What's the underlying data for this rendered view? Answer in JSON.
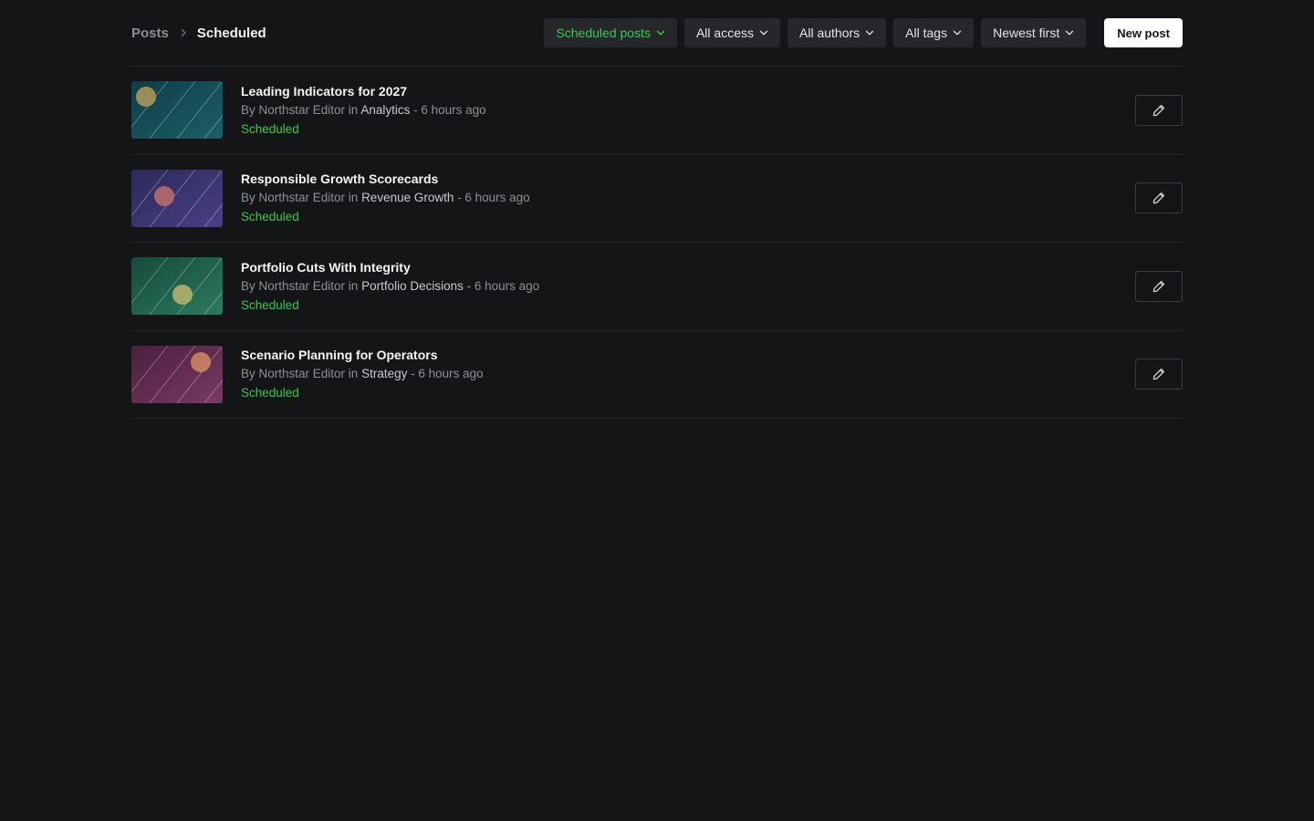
{
  "breadcrumb": {
    "root": "Posts",
    "current": "Scheduled"
  },
  "filters": [
    {
      "label": "Scheduled posts",
      "active": true
    },
    {
      "label": "All access",
      "active": false
    },
    {
      "label": "All authors",
      "active": false
    },
    {
      "label": "All tags",
      "active": false
    },
    {
      "label": "Newest first",
      "active": false
    }
  ],
  "new_post_label": "New post",
  "posts": [
    {
      "title": "Leading Indicators for 2027",
      "by": "By Northstar Editor in",
      "tag": "Analytics",
      "time": "- 6 hours ago",
      "status": "Scheduled",
      "thumb_colors": [
        "#0f3d48",
        "#1c5f66",
        "#b39a5c"
      ]
    },
    {
      "title": "Responsible Growth Scorecards",
      "by": "By Northstar Editor in",
      "tag": "Revenue Growth",
      "time": "- 6 hours ago",
      "status": "Scheduled",
      "thumb_colors": [
        "#2b2a5a",
        "#4a3f85",
        "#c16d6d"
      ]
    },
    {
      "title": "Portfolio Cuts With Integrity",
      "by": "By Northstar Editor in",
      "tag": "Portfolio Decisions",
      "time": "- 6 hours ago",
      "status": "Scheduled",
      "thumb_colors": [
        "#164a3c",
        "#2c7a5e",
        "#b9b56e"
      ]
    },
    {
      "title": "Scenario Planning for Operators",
      "by": "By Northstar Editor in",
      "tag": "Strategy",
      "time": "- 6 hours ago",
      "status": "Scheduled",
      "thumb_colors": [
        "#4a1f3e",
        "#7a3a63",
        "#d08a62"
      ]
    }
  ],
  "colors": {
    "background": "#141517",
    "accent_green": "#3ec653",
    "filter_bg": "#25272b",
    "divider": "#26282b"
  },
  "icons": {
    "breadcrumb_separator": "chevron-right-icon",
    "filter_caret": "chevron-down-icon",
    "edit": "pencil-icon"
  }
}
